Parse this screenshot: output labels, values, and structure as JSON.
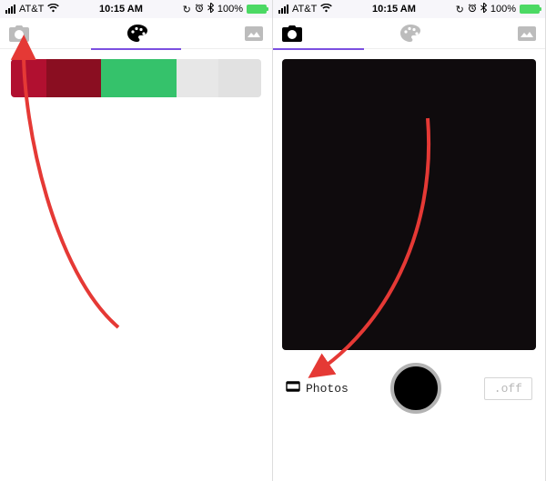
{
  "statusbar": {
    "carrier": "AT&T",
    "time": "10:15 AM",
    "battery_pct": "100%"
  },
  "nav": {
    "camera": "camera",
    "palette": "palette",
    "gallery": "gallery"
  },
  "camera": {
    "photos_label": "Photos",
    "off_label": ".off"
  }
}
